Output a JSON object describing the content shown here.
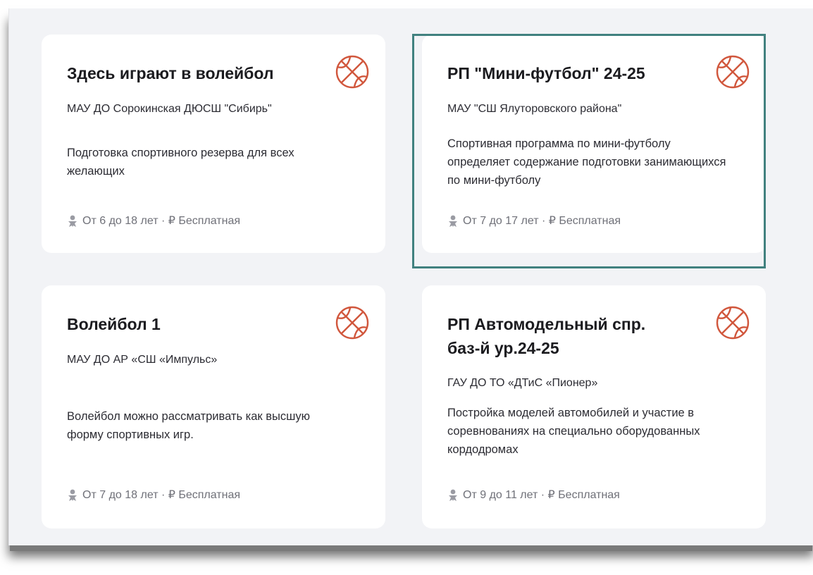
{
  "colors": {
    "accent": "#d1573d",
    "selection": "#41817f",
    "meta": "#6f7078"
  },
  "cards": [
    {
      "title": "Здесь играют в волейбол",
      "org": "МАУ ДО Сорокинская ДЮСШ \"Сибирь\"",
      "description": "Подготовка спортивного резерва для всех желающих",
      "meta": "От 6 до 18 лет · ₽ Бесплатная",
      "icon": "basketball-icon",
      "selected": false
    },
    {
      "title": "РП \"Мини-футбол\" 24-25",
      "org": "МАУ \"СШ Ялуторовского района\"",
      "description": "Спортивная программа по мини-футболу определяет содержание подготовки занимающихся по мини-футболу",
      "meta": "От 7 до 17 лет · ₽ Бесплатная",
      "icon": "basketball-icon",
      "selected": true
    },
    {
      "title": "Волейбол 1",
      "org": "МАУ ДО АР «СШ «Импульс»",
      "description": "Волейбол можно рассматривать как высшую форму спортивных игр.",
      "meta": "От 7 до 18 лет · ₽ Бесплатная",
      "icon": "basketball-icon",
      "selected": false
    },
    {
      "title": "РП Автомодельный спр. баз-й ур.24-25",
      "org": "ГАУ ДО ТО «ДТиС «Пионер»",
      "description": "Постройка моделей автомобилей и участие в соревнованиях на специально оборудованных кордодромах",
      "meta": "От 9 до 11 лет · ₽ Бесплатная",
      "icon": "basketball-icon",
      "selected": false
    }
  ]
}
